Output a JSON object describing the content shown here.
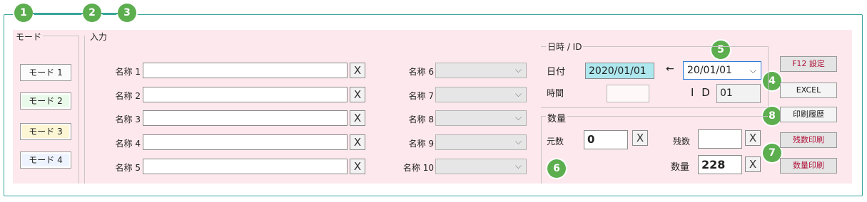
{
  "badges": [
    "1",
    "2",
    "3",
    "4",
    "5",
    "6",
    "7",
    "8"
  ],
  "mode_group": {
    "label": "モード",
    "buttons": [
      {
        "label": "モード 1",
        "color": "#fbfbfb"
      },
      {
        "label": "モード 2",
        "color": "#eafaea"
      },
      {
        "label": "モード 3",
        "color": "#fdf6d4"
      },
      {
        "label": "モード 4",
        "color": "#eef4ff"
      }
    ]
  },
  "input_group": {
    "label": "入力",
    "names_left": [
      "名称 1",
      "名称 2",
      "名称 3",
      "名称 4",
      "名称 5"
    ],
    "names_right": [
      "名称 6",
      "名称 7",
      "名称 8",
      "名称 9",
      "名称 10"
    ],
    "clear_glyph": "X",
    "chevron": "⌵"
  },
  "datetime_group": {
    "label": "日時 / ID",
    "date_label": "日付",
    "date_value": "2020/01/01",
    "arrow": "←",
    "date_select": "20/01/01",
    "time_label": "時間",
    "time_value": "",
    "id_label": "I D",
    "id_value": "01"
  },
  "quantity_group": {
    "label": "数量",
    "base_label": "元数",
    "base_value": "0",
    "remain_label": "残数",
    "remain_value": "",
    "qty_label": "数量",
    "qty_value": "228"
  },
  "right_buttons": {
    "f12": "F12 設定",
    "excel": "EXCEL",
    "history": "印刷履歴",
    "remain_print": "残数印刷",
    "qty_print": "数量印刷"
  },
  "colors": {
    "accent": "#3aa59a",
    "badge": "#5cae4f",
    "panel": "#fde8ed",
    "date_field": "#aee8ee",
    "red_text": "#b0123a"
  }
}
